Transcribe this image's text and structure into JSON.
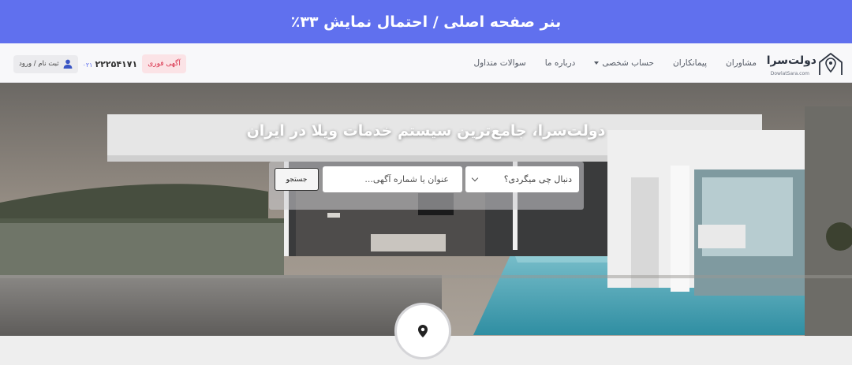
{
  "banner": {
    "text": "بنر صفحه اصلی / احتمال نمایش ۳۳٪"
  },
  "brand": {
    "name": "دولت‌سرا",
    "site": "DowlatSara.com"
  },
  "nav": {
    "items": [
      {
        "label": "مشاوران"
      },
      {
        "label": "پیمانکاران"
      },
      {
        "label": "حساب شخصی",
        "dropdown": true
      },
      {
        "label": "درباره ما"
      },
      {
        "label": "سوالات متداول"
      }
    ]
  },
  "actions": {
    "ad_label": "آگهی فوری",
    "phone_number": "۲۲۲۵۴۱۷۱",
    "phone_code": "۰۲۱",
    "login_label": "ثبت نام / ورود"
  },
  "hero": {
    "title": "دولت‌سرا، جامع‌ترین سیستم خدمات ویلا در ایران"
  },
  "search": {
    "select_value": "دنبال چی میگردی؟",
    "input_placeholder": "عنوان یا شماره آگهی...",
    "input_value": "",
    "button_label": "جستجو"
  },
  "icons": {
    "logo": "house-pin-icon",
    "user": "user-icon",
    "select": "chevron-down-icon",
    "map": "map-pin-icon"
  },
  "colors": {
    "banner": "#6070ee",
    "ad_button_bg": "#fbe3e6",
    "ad_button_text": "#d9304a",
    "phone_code": "#6070ee"
  }
}
